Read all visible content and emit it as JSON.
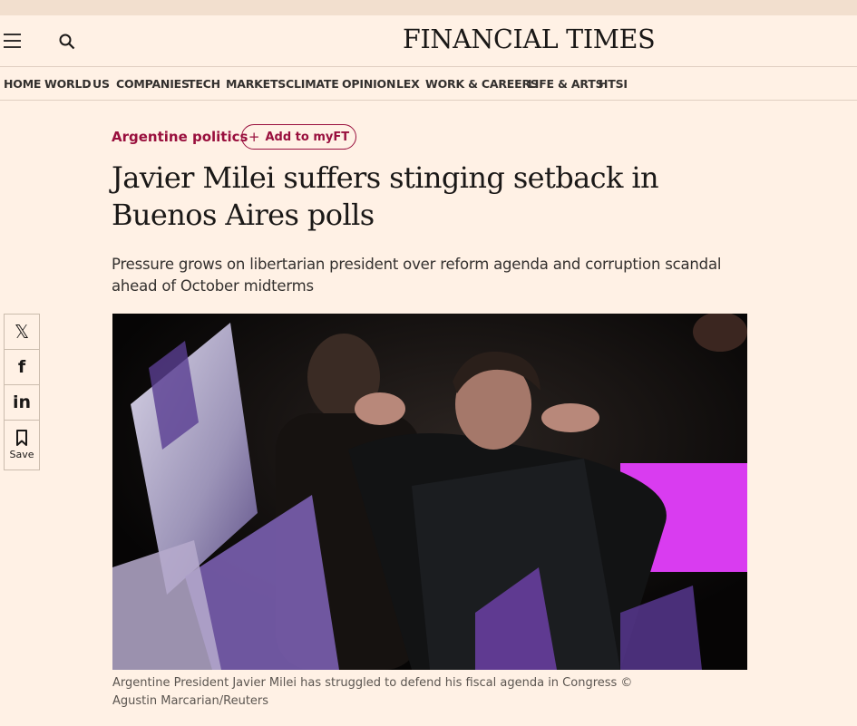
{
  "header": {
    "logo": "FINANCIAL TIMES"
  },
  "nav": {
    "items": [
      {
        "label": "HOME"
      },
      {
        "label": "WORLD"
      },
      {
        "label": "US"
      },
      {
        "label": "COMPANIES"
      },
      {
        "label": "TECH"
      },
      {
        "label": "MARKETS"
      },
      {
        "label": "CLIMATE"
      },
      {
        "label": "OPINION"
      },
      {
        "label": "LEX"
      },
      {
        "label": "WORK & CAREERS"
      },
      {
        "label": "LIFE & ARTS"
      },
      {
        "label": "HTSI"
      }
    ]
  },
  "article": {
    "topic": "Argentine politics",
    "add_myft_label": "Add to myFT",
    "add_myft_icon": "+",
    "headline": "Javier Milei suffers stinging setback in Buenos Aires polls",
    "standfirst": "Pressure grows on libertarian president over reform agenda and corruption scandal ahead of October midterms",
    "caption": "Argentine President Javier Milei has struggled to defend his fiscal agenda in Congress © Agustin Marcarian/Reuters"
  },
  "share": {
    "x_glyph": "𝕏",
    "facebook_glyph": "f",
    "linkedin_glyph": "in",
    "save_label": "Save"
  },
  "colors": {
    "background": "#fff1e5",
    "topic": "#990f3d",
    "text": "#33302e",
    "photo_accent": "#d93cf0"
  }
}
